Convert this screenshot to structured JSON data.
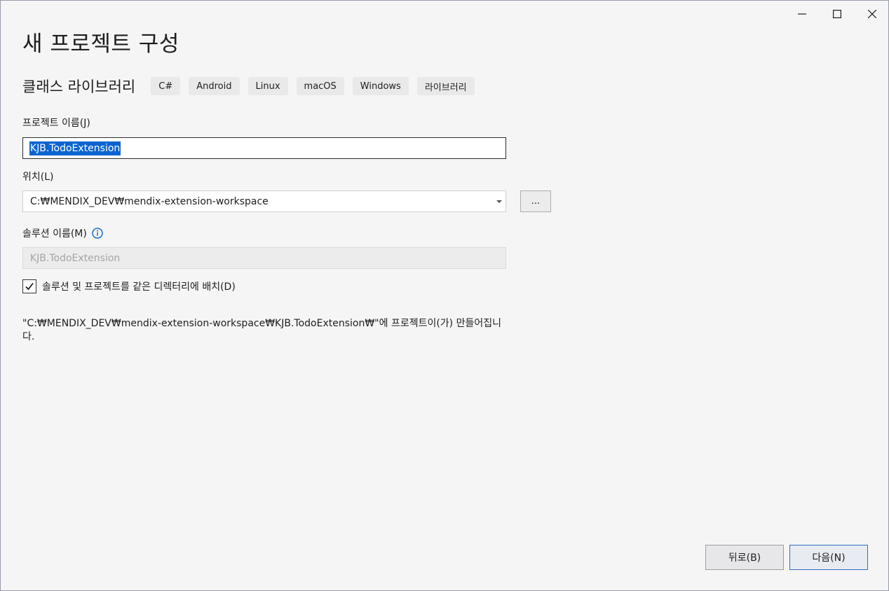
{
  "window": {
    "controls": {
      "minimize_icon": "minimize-icon",
      "maximize_icon": "maximize-icon",
      "close_icon": "close-icon"
    }
  },
  "page_title": "새 프로젝트 구성",
  "template": {
    "name": "클래스 라이브러리",
    "tags": [
      "C#",
      "Android",
      "Linux",
      "macOS",
      "Windows",
      "라이브러리"
    ]
  },
  "project_name": {
    "label": "프로젝트 이름(J)",
    "value": "KJB.TodoExtension"
  },
  "location": {
    "label": "위치(L)",
    "value": "C:₩MENDIX_DEV₩mendix-extension-workspace",
    "browse_label": "..."
  },
  "solution_name": {
    "label": "솔루션 이름(M)",
    "placeholder": "KJB.TodoExtension",
    "info_icon": "info-icon"
  },
  "place_in_same_dir": {
    "label": "솔루션 및 프로젝트를 같은 디렉터리에 배치(D)",
    "checked": true
  },
  "creation_message": "\"C:₩MENDIX_DEV₩mendix-extension-workspace₩KJB.TodoExtension₩\"에 프로젝트이(가) 만들어집니다.",
  "buttons": {
    "back": "뒤로(B)",
    "next": "다음(N)"
  },
  "colors": {
    "background": "#f5f5f5",
    "selection": "#0a64d0",
    "info_icon": "#1a6fc9",
    "primary_border": "#2f6dc4"
  }
}
